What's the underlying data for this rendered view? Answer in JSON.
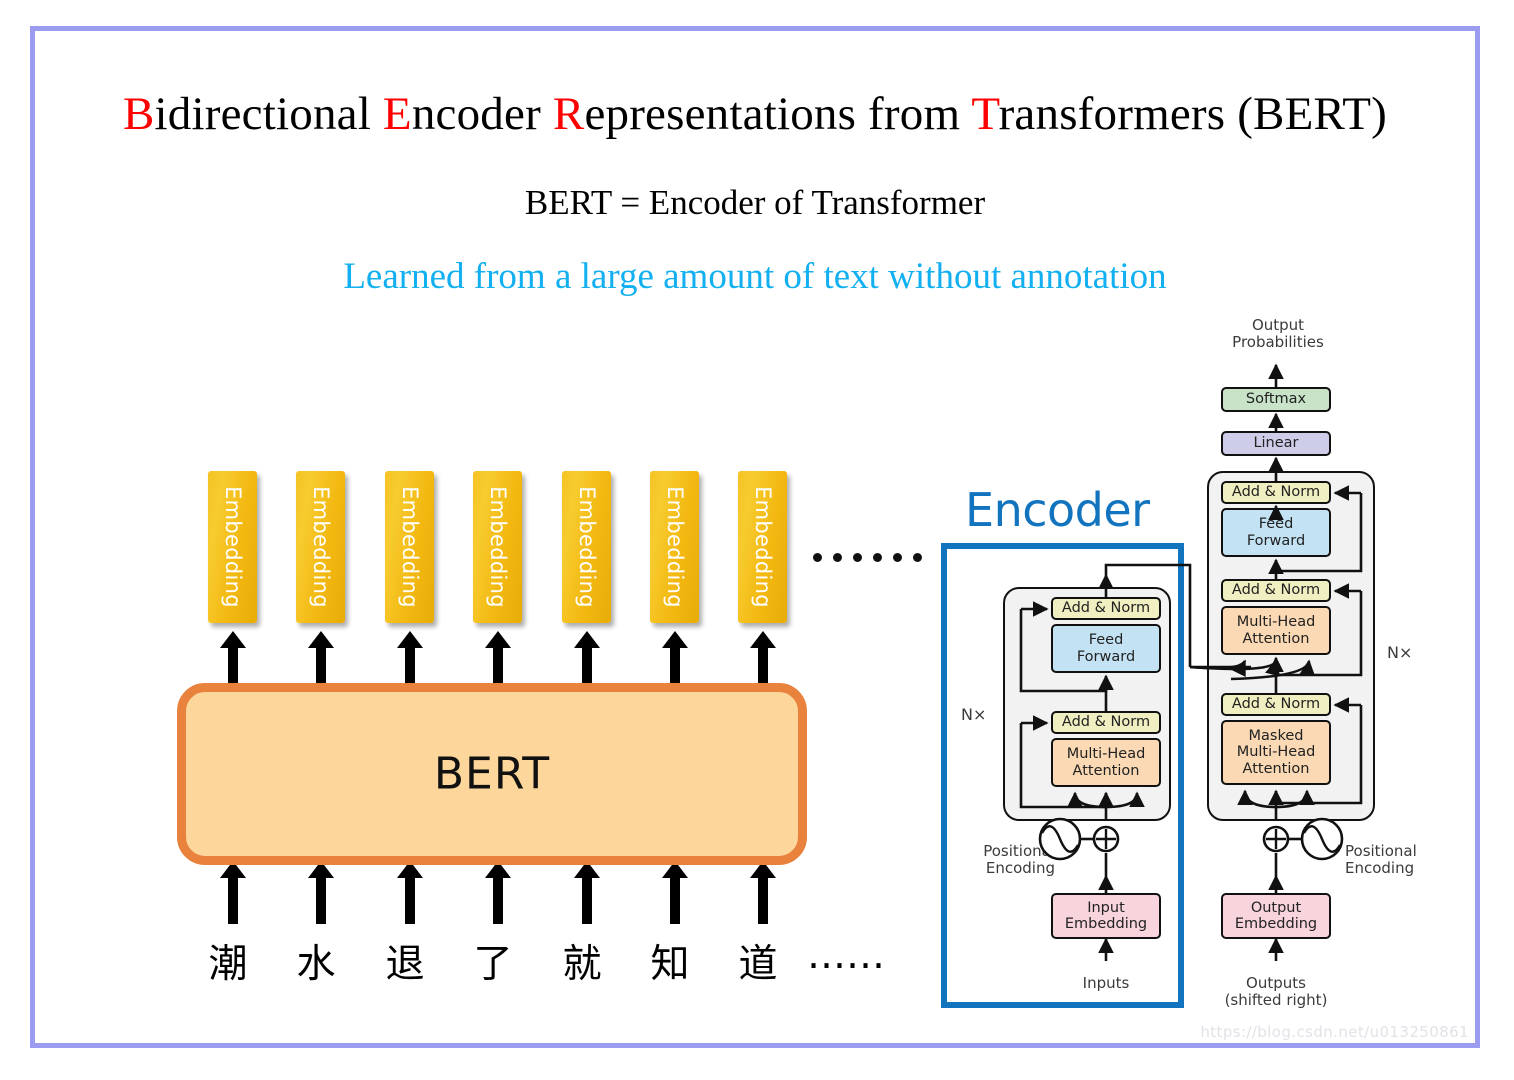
{
  "slide": {
    "border_color": "#9b9bf0",
    "title_parts": [
      {
        "text": "B",
        "highlight": true
      },
      {
        "text": "idirectional ",
        "highlight": false
      },
      {
        "text": "E",
        "highlight": true
      },
      {
        "text": "ncoder ",
        "highlight": false
      },
      {
        "text": "R",
        "highlight": true
      },
      {
        "text": "epresentations from ",
        "highlight": false
      },
      {
        "text": "T",
        "highlight": true
      },
      {
        "text": "ransformers (BERT)",
        "highlight": false
      }
    ],
    "title_plain": "Bidirectional Encoder Representations from Transformers (BERT)",
    "subtitle1": "BERT =  Encoder of Transformer",
    "subtitle2": "Learned from a large amount of text without annotation",
    "subtitle2_color": "#12b0f0",
    "highlight_color": "#ff0000",
    "watermark": "https://blog.csdn.net/u013250861"
  },
  "bert_diagram": {
    "model_label": "BERT",
    "model_fill": "#fcd69a",
    "model_border": "#e8823c",
    "embedding_label": "Embedding",
    "embedding_count": 7,
    "embedding_fill": "#f3bb12",
    "tokens": [
      "潮",
      "水",
      "退",
      "了",
      "就",
      "知",
      "道"
    ],
    "token_ellipsis": "……",
    "embedding_ellipsis": "……"
  },
  "transformer": {
    "encoder_label": "Encoder",
    "encoder_label_color": "#1273be",
    "output_probabilities": "Output\nProbabilities",
    "softmax": "Softmax",
    "linear": "Linear",
    "add_norm": "Add & Norm",
    "feed_forward": "Feed\nForward",
    "multi_head_attention": "Multi-Head\nAttention",
    "masked_multi_head_attention": "Masked\nMulti-Head\nAttention",
    "input_embedding": "Input\nEmbedding",
    "output_embedding": "Output\nEmbedding",
    "positional_encoding_left": "Positional\nEncoding",
    "positional_encoding_right": "Positional\nEncoding",
    "nx_left": "N×",
    "nx_right": "N×",
    "inputs": "Inputs",
    "outputs": "Outputs\n(shifted right)",
    "colors": {
      "add_norm": "#f0efc2",
      "feed_forward": "#c3e3f4",
      "attention": "#fad9b4",
      "embedding": "#f8d4dd",
      "linear": "#cdcdea",
      "softmax": "#c8e3c8",
      "subblock": "#f2f2f2"
    }
  }
}
